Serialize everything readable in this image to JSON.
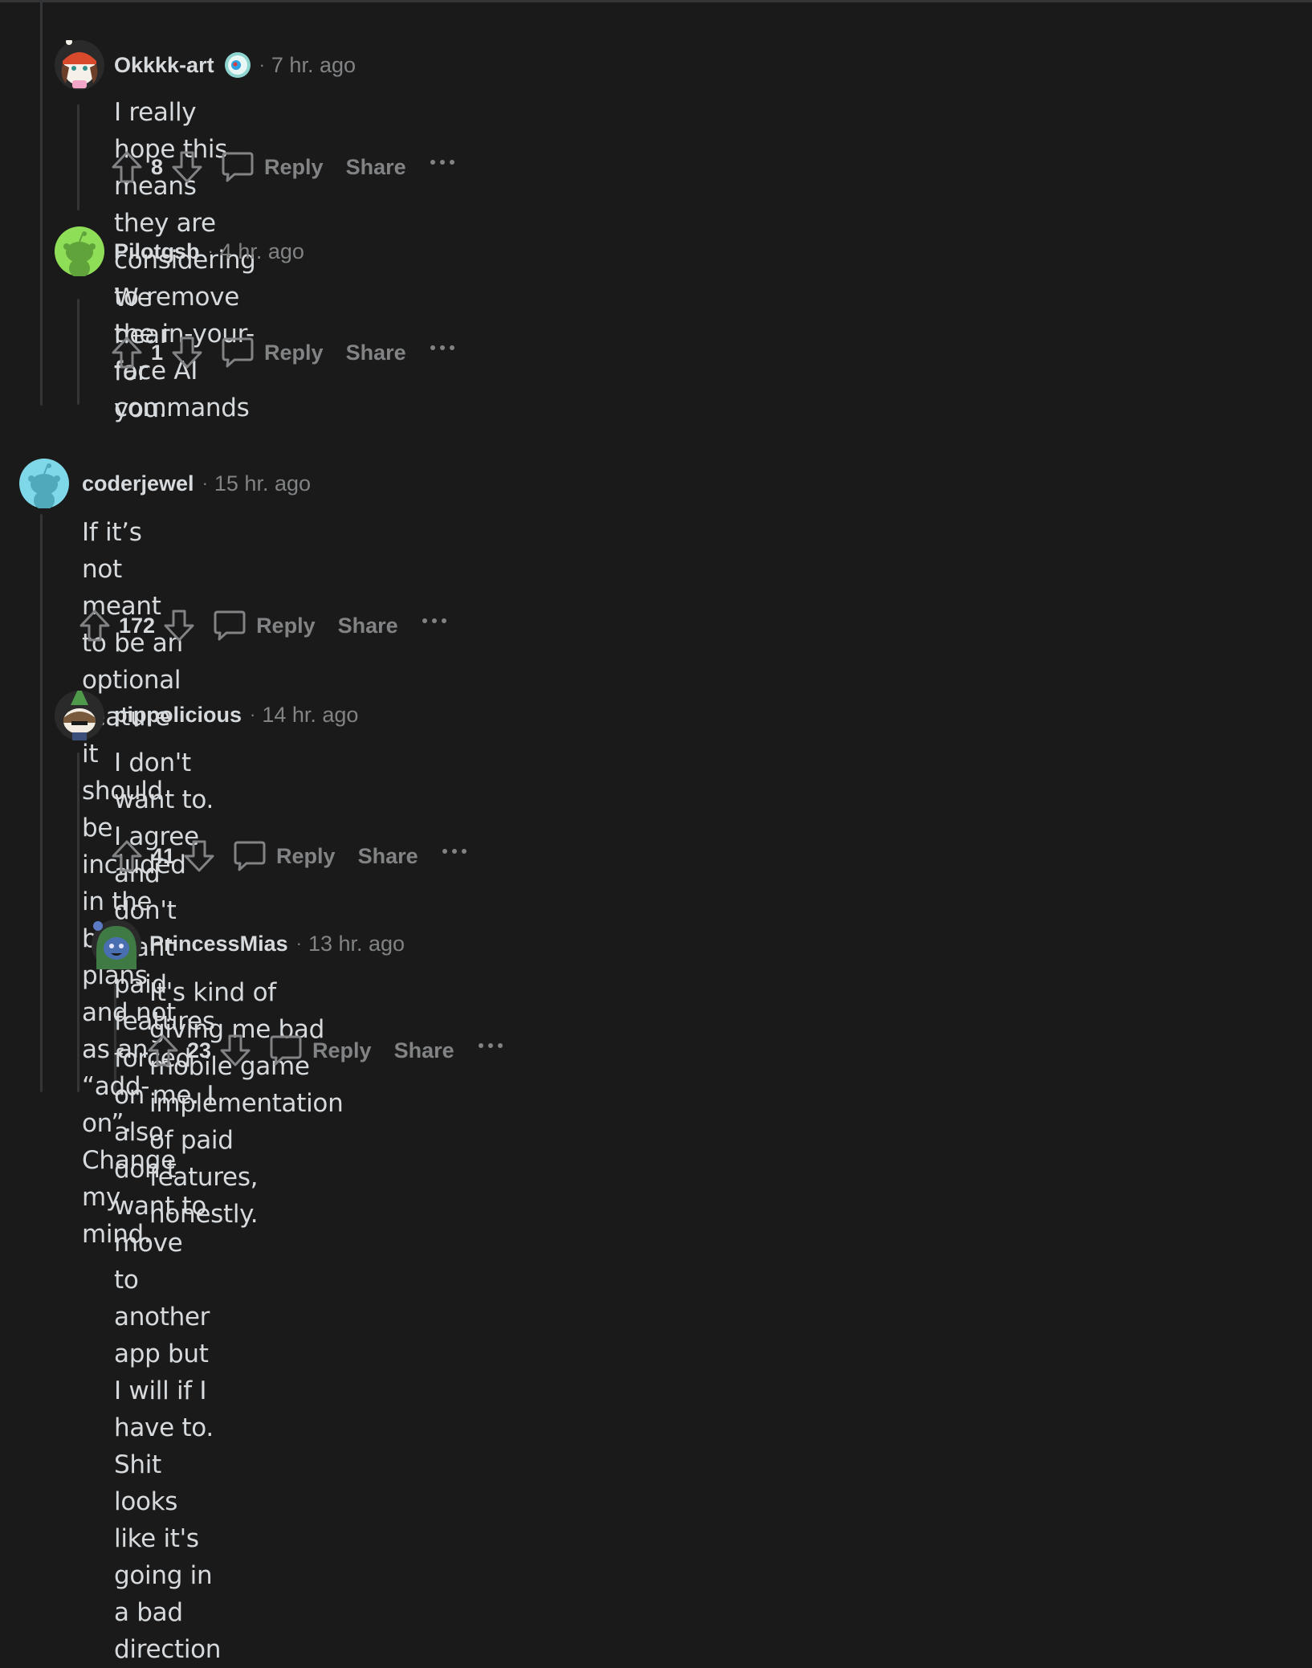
{
  "comments": [
    {
      "username": "Okkkk-art",
      "separator": "·",
      "time": "7 hr. ago",
      "body": "I really hope this means they are considering to remove the in-your-face AI commands",
      "score": "8",
      "reply_label": "Reply",
      "share_label": "Share",
      "avatar": "snoo-avatar-redhat",
      "flair_icon": "eye-flair-icon"
    },
    {
      "username": "Pilotgsb",
      "separator": "·",
      "time": "4 hr. ago",
      "body": "We hear for you.",
      "score": "1",
      "reply_label": "Reply",
      "share_label": "Share",
      "avatar": "snoo-avatar-green"
    },
    {
      "username": "coderjewel",
      "separator": "·",
      "time": "15 hr. ago",
      "body_lines": [
        "If it’s not meant to be an optional feature it should be included in the base plans and not as an",
        "“add-on”. Change my mind."
      ],
      "score": "172",
      "reply_label": "Reply",
      "share_label": "Share",
      "avatar": "snoo-avatar-cyan"
    },
    {
      "username": "pippolicious",
      "separator": "·",
      "time": "14 hr. ago",
      "body_lines": [
        "I don't want to. I agree and don't want paid features forced on me. I also don't want to move",
        "to another app but I will if I have to. Shit looks like it's going in a bad direction"
      ],
      "score": "41",
      "reply_label": "Reply",
      "share_label": "Share",
      "avatar": "snoo-avatar-tree-hat"
    },
    {
      "username": "PrincessMias",
      "separator": "·",
      "time": "13 hr. ago",
      "body": "It's kind of giving me bad mobile game implementation of paid features, honestly.",
      "score": "23",
      "reply_label": "Reply",
      "share_label": "Share",
      "avatar": "snoo-avatar-green-hood"
    }
  ],
  "colors": {
    "background": "#1a1a1b",
    "thread_line": "#343536",
    "text_primary": "#d7dadc",
    "text_secondary": "#818384",
    "avatar_green": "#8fde58",
    "avatar_cyan": "#7fd8e8"
  }
}
